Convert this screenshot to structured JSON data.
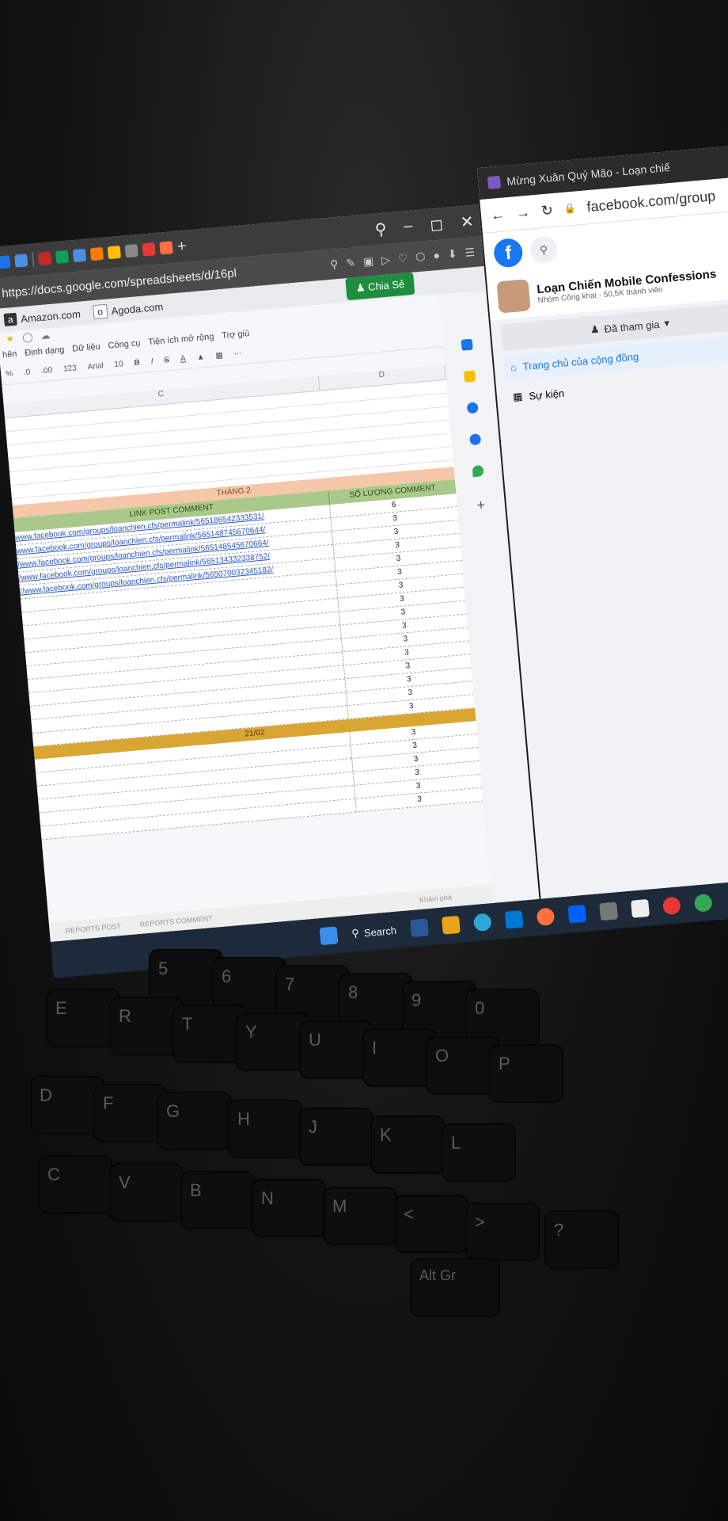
{
  "left_browser": {
    "url": "https://docs.google.com/spreadsheets/d/16pl",
    "bookmarks": [
      {
        "icon": "amazon-icon",
        "label": "Amazon.com"
      },
      {
        "icon": "agoda-icon",
        "label": "Agoda.com"
      }
    ],
    "share_label": "Chia Sẻ",
    "menus": [
      "hên",
      "Định dạng",
      "Dữ liệu",
      "Công cụ",
      "Tiện ích mở rộng",
      "Trợ giú"
    ],
    "toolbar": {
      "zoom": "123",
      "font": "Arial",
      "size": "10",
      "bold": "B",
      "italic": "I",
      "strike": "S",
      "color": "A"
    },
    "columns": [
      "C",
      "D"
    ],
    "section_title": "THÁNG 2",
    "header_link": "LINK POST COMMENT",
    "header_count": "SỐ LƯỢNG COMMENT",
    "rows": [
      {
        "link": "www.facebook.com/groups/loanchien.cfs/permalink/565186542333531/",
        "count": "6"
      },
      {
        "link": "www.facebook.com/groups/loanchien.cfs/permalink/565148745670644/",
        "count": "3"
      },
      {
        "link": "/www.facebook.com/groups/loanchien.cfs/permalink/565148545670664/",
        "count": "3"
      },
      {
        "link": "/www.facebook.com/groups/loanchien.cfs/permalink/565134332338752/",
        "count": "3"
      },
      {
        "link": "//www.facebook.com/groups/loanchien.cfs/permalink/565070032345182/",
        "count": "3"
      },
      {
        "link": "",
        "count": "3"
      },
      {
        "link": "",
        "count": "3"
      },
      {
        "link": "",
        "count": "3"
      },
      {
        "link": "",
        "count": "3"
      },
      {
        "link": "",
        "count": "3"
      },
      {
        "link": "",
        "count": "3"
      },
      {
        "link": "",
        "count": "3"
      },
      {
        "link": "",
        "count": "3"
      },
      {
        "link": "",
        "count": "3"
      },
      {
        "link": "",
        "count": "3"
      },
      {
        "link": "",
        "count": "3"
      }
    ],
    "divider_label": "21/02",
    "rows2": [
      "3",
      "3",
      "3",
      "3",
      "3",
      "3"
    ],
    "sheet_tabs": [
      "REPORTS POST",
      "REPORTS COMMENT"
    ],
    "explore_label": "Khám phá"
  },
  "right_browser": {
    "tab_title": "Mừng Xuân Quý Mão - Loạn chiế",
    "url": "facebook.com/group",
    "group_name": "Loạn Chiến Mobile Confessions",
    "group_meta": "Nhóm Công khai · 50,5K thành viên",
    "joined_label": "Đã tham gia",
    "nav": [
      {
        "icon": "home-icon",
        "label": "Trang chủ của cộng đồng",
        "active": true
      },
      {
        "icon": "calendar-icon",
        "label": "Sự kiện",
        "active": false
      }
    ]
  },
  "taskbar": {
    "search_label": "Search"
  },
  "keyboard": {
    "keys": [
      "E",
      "R",
      "T",
      "Y",
      "U",
      "I",
      "O",
      "P",
      "D",
      "F",
      "G",
      "H",
      "J",
      "K",
      "L",
      "C",
      "V",
      "B",
      "N",
      "M",
      "<",
      ">",
      "?",
      "Alt Gr",
      "5",
      "6",
      "7",
      "8",
      "9",
      "0"
    ]
  },
  "colors": {
    "accent_green": "#1e8e3e",
    "facebook_blue": "#1877f2",
    "month_orange": "#f4c7a8",
    "header_green": "#a9c98a",
    "divider_gold": "#d9a634"
  }
}
